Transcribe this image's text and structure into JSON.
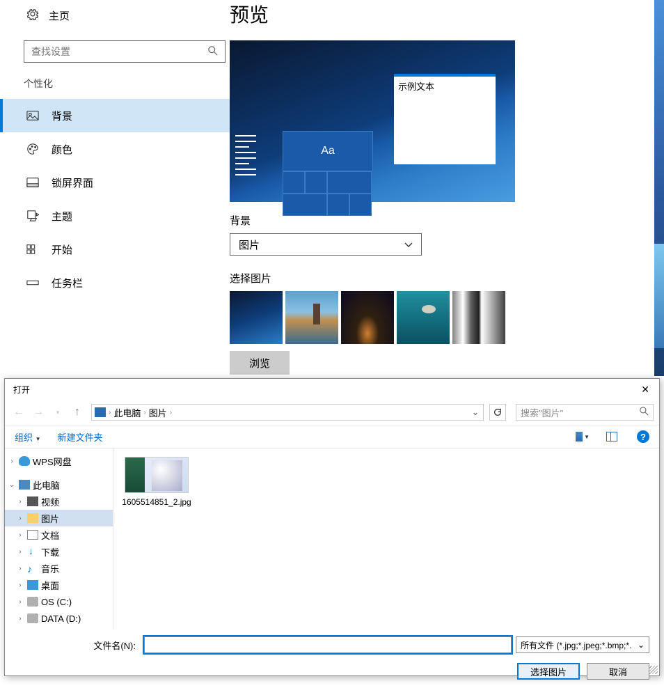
{
  "sidebar": {
    "home": "主页",
    "search_placeholder": "查找设置",
    "section": "个性化",
    "items": [
      {
        "label": "背景"
      },
      {
        "label": "颜色"
      },
      {
        "label": "锁屏界面"
      },
      {
        "label": "主题"
      },
      {
        "label": "开始"
      },
      {
        "label": "任务栏"
      }
    ]
  },
  "content": {
    "title": "预览",
    "sample_text": "示例文本",
    "aa_label": "Aa",
    "bg_label": "背景",
    "bg_value": "图片",
    "choose_label": "选择图片",
    "browse": "浏览"
  },
  "dialog": {
    "title": "打开",
    "breadcrumb": {
      "root": "此电脑",
      "folder": "图片"
    },
    "search_placeholder": "搜索\"图片\"",
    "toolbar": {
      "organize": "组织",
      "newfolder": "新建文件夹"
    },
    "tree": {
      "wps": "WPS网盘",
      "pc": "此电脑",
      "video": "视频",
      "pictures": "图片",
      "docs": "文档",
      "downloads": "下载",
      "music": "音乐",
      "desktop": "桌面",
      "osc": "OS (C:)",
      "datad": "DATA (D:)"
    },
    "file": {
      "name": "1605514851_2.jpg"
    },
    "fn_label": "文件名(N):",
    "filter": "所有文件 (*.jpg;*.jpeg;*.bmp;*.",
    "ok": "选择图片",
    "cancel": "取消"
  }
}
